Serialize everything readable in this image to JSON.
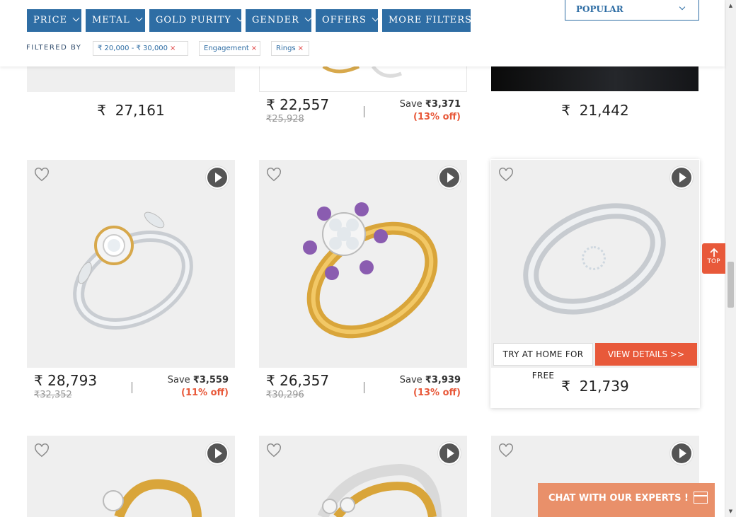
{
  "filters": {
    "buttons": [
      "PRICE",
      "METAL",
      "GOLD PURITY",
      "GENDER",
      "OFFERS",
      "MORE FILTERS"
    ],
    "sort_label": "POPULAR",
    "filtered_by_label": "FILTERED BY",
    "chips": [
      "₹ 20,000 - ₹ 30,000",
      "Engagement",
      "Rings"
    ],
    "chip_remove": "×"
  },
  "currency": "₹",
  "row1": [
    {
      "price": "27,161"
    },
    {
      "price": "22,557",
      "old_price": "25,928",
      "save_label": "Save",
      "save_amount": "3,371",
      "off": "(13% off)"
    },
    {
      "price": "21,442"
    }
  ],
  "row2": [
    {
      "price": "28,793",
      "old_price": "32,352",
      "save_label": "Save",
      "save_amount": "3,559",
      "off": "(11% off)"
    },
    {
      "price": "26,357",
      "old_price": "30,296",
      "save_label": "Save",
      "save_amount": "3,939",
      "off": "(13% off)"
    },
    {
      "price": "21,739",
      "try_label": "TRY AT HOME FOR FREE",
      "view_label": "VIEW DETAILS >>"
    }
  ],
  "top_button": "TOP",
  "chat_label": "CHAT WITH OUR EXPERTS !",
  "colors": {
    "primary": "#2e6da4",
    "accent": "#e8593a",
    "chat": "#e9906a"
  },
  "icons": [
    "heart-icon",
    "play-icon",
    "chevron-down-icon",
    "arrow-up-icon",
    "chat-window-icon"
  ]
}
